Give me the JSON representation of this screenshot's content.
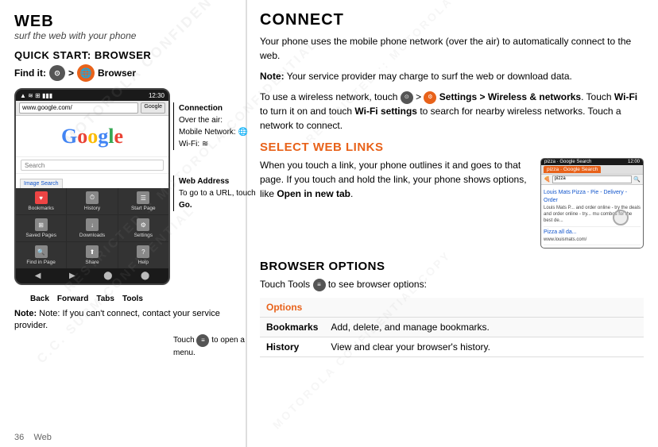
{
  "left": {
    "title": "WEB",
    "subtitle": "surf the web with your phone",
    "quick_start_title": "QUICK START: BROWSER",
    "find_it_label": "Find it:",
    "find_it_separator": ">",
    "find_it_browser": "Browser",
    "phone": {
      "status_left": "wifi signal battery",
      "status_right": "12:30",
      "address_url": "www.google.com/",
      "address_btn": "Google",
      "search_placeholder": "Search",
      "image_search": "Image Search",
      "menu_items": [
        {
          "icon": "♥",
          "label": "Bookmarks"
        },
        {
          "icon": "⏱",
          "label": "History"
        },
        {
          "icon": "☰",
          "label": "Start Page"
        },
        {
          "icon": "⊞",
          "label": "Saved Pages"
        },
        {
          "icon": "↓",
          "label": "Downloads"
        },
        {
          "icon": "⚙",
          "label": "Settings"
        },
        {
          "icon": "🔍",
          "label": "Find in Page"
        },
        {
          "icon": "⬆",
          "label": "Share"
        },
        {
          "icon": "?",
          "label": "Help"
        }
      ],
      "nav_back": "Back",
      "nav_forward": "Forward",
      "nav_tabs": "Tabs",
      "nav_tools": "Tools"
    },
    "callout_connection_title": "Connection",
    "callout_connection_line1": "Over the air:",
    "callout_connection_line2": "Mobile Network:",
    "callout_connection_wifi": "Wi-Fi:",
    "callout_web_address_title": "Web Address",
    "callout_web_address_body": "To go to a URL, touch",
    "callout_web_address_go": "Go.",
    "callout_menu": "Touch",
    "callout_menu_action": "to open a menu.",
    "note": "Note: If you can't connect, contact your service provider.",
    "page_number": "36",
    "page_label": "Web"
  },
  "right": {
    "connect_title": "CONNECT",
    "connect_p1": "Your phone uses the mobile phone network (over the air) to automatically connect to the web.",
    "connect_p2_note": "Note:",
    "connect_p2_body": " Your service provider may charge to surf the web or download data.",
    "connect_p3_start": "To use a wireless network, touch",
    "connect_p3_settings": "Settings >",
    "connect_p3_wireless": "Wireless & networks",
    "connect_p3_mid": ". Touch",
    "connect_p3_wifi": "Wi-Fi",
    "connect_p3_body": " to turn it on and touch",
    "connect_p3_wifi_settings": "Wi-Fi settings",
    "connect_p3_end": " to search for nearby wireless networks. Touch a network to connect.",
    "select_title": "SELECT WEB LINKS",
    "select_body": "When you touch a link, your phone outlines it and goes to that page. If you touch and hold the link, your phone shows options, like",
    "select_open_tab": "Open in new tab",
    "select_end": ".",
    "mini_phone": {
      "status_left": "pizza  Google Search",
      "status_right": "12:00",
      "tab_label": "pizza · Google Search",
      "search_value": "pizza",
      "result1_title": "Louis Mats Pizza - Pie - Delivery - Order",
      "result1_url": "Louis Mats P...",
      "result1_desc": "and order online - try the deals and order online - try... mu combos for the best de...",
      "result2_url": "www.louismats.com/"
    },
    "browser_options_title": "BROWSER OPTIONS",
    "browser_options_intro": "Touch Tools",
    "browser_options_end": "to see browser options:",
    "table": {
      "header": "Options",
      "rows": [
        {
          "option": "Bookmarks",
          "description": "Add, delete, and manage bookmarks."
        },
        {
          "option": "History",
          "description": "View and clear your browser's history."
        }
      ]
    }
  }
}
